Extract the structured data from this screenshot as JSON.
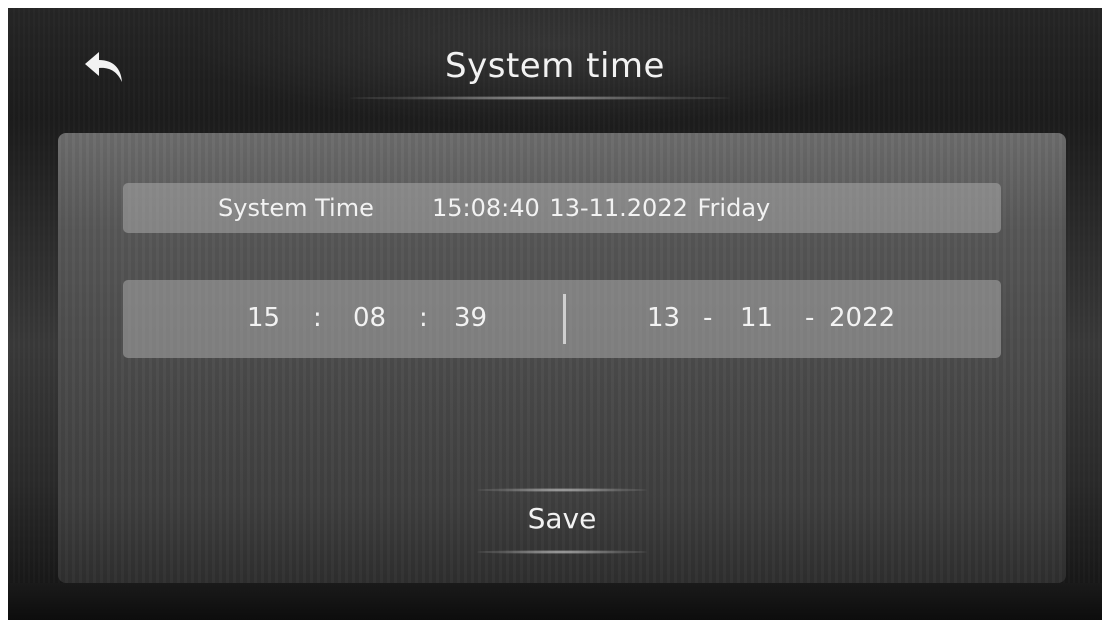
{
  "header": {
    "title": "System time",
    "back_icon": "back-arrow-icon"
  },
  "current_time": {
    "label": "System Time",
    "value": "15:08:40  13-11.2022  Friday"
  },
  "editor": {
    "hour": "15",
    "minute": "08",
    "second": "39",
    "time_sep": ":",
    "day": "13",
    "month": "11",
    "year": "2022",
    "date_sep": "-"
  },
  "actions": {
    "save_label": "Save"
  },
  "colors": {
    "text": "#f2f2f2",
    "row_background": "#8a8a8a",
    "panel_background": "#575757",
    "screen_background": "#1c1c1c"
  }
}
